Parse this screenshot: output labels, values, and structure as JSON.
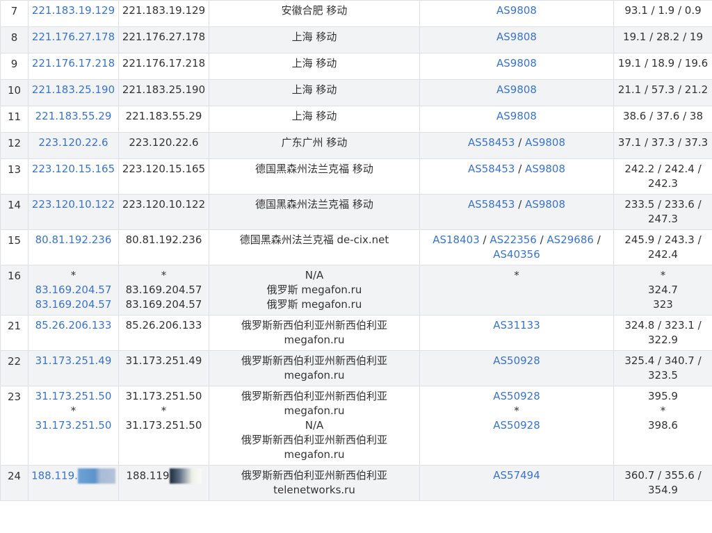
{
  "colors": {
    "link": "#3b73c7",
    "text": "#333333",
    "border": "#dcdfe3",
    "row_alt": "#f1f3f5"
  },
  "rows": [
    {
      "hop": "7",
      "ip_link": [
        "221.183.19.129"
      ],
      "ip": [
        "221.183.19.129"
      ],
      "location": [
        "安徽合肥 移动"
      ],
      "asn": [
        [
          "AS9808"
        ]
      ],
      "latency": [
        "93.1 / 1.9 / 0.9"
      ]
    },
    {
      "hop": "8",
      "ip_link": [
        "221.176.27.178"
      ],
      "ip": [
        "221.176.27.178"
      ],
      "location": [
        "上海 移动"
      ],
      "asn": [
        [
          "AS9808"
        ]
      ],
      "latency": [
        "19.1 / 28.2 / 19"
      ]
    },
    {
      "hop": "9",
      "ip_link": [
        "221.176.17.218"
      ],
      "ip": [
        "221.176.17.218"
      ],
      "location": [
        "上海 移动"
      ],
      "asn": [
        [
          "AS9808"
        ]
      ],
      "latency": [
        "19.1 / 18.9 / 19.6"
      ]
    },
    {
      "hop": "10",
      "ip_link": [
        "221.183.25.190"
      ],
      "ip": [
        "221.183.25.190"
      ],
      "location": [
        "上海 移动"
      ],
      "asn": [
        [
          "AS9808"
        ]
      ],
      "latency": [
        "21.1 / 57.3 / 21.2"
      ]
    },
    {
      "hop": "11",
      "ip_link": [
        "221.183.55.29"
      ],
      "ip": [
        "221.183.55.29"
      ],
      "location": [
        "上海 移动"
      ],
      "asn": [
        [
          "AS9808"
        ]
      ],
      "latency": [
        "38.6 / 37.6 / 38"
      ]
    },
    {
      "hop": "12",
      "ip_link": [
        "223.120.22.6"
      ],
      "ip": [
        "223.120.22.6"
      ],
      "location": [
        "广东广州 移动"
      ],
      "asn": [
        [
          "AS58453",
          "AS9808"
        ]
      ],
      "latency": [
        "37.1 / 37.3 / 37.3"
      ]
    },
    {
      "hop": "13",
      "ip_link": [
        "223.120.15.165"
      ],
      "ip": [
        "223.120.15.165"
      ],
      "location": [
        "德国黑森州法兰克福 移动"
      ],
      "asn": [
        [
          "AS58453",
          "AS9808"
        ]
      ],
      "latency": [
        "242.2 / 242.4 /",
        "242.3"
      ]
    },
    {
      "hop": "14",
      "ip_link": [
        "223.120.10.122"
      ],
      "ip": [
        "223.120.10.122"
      ],
      "location": [
        "德国黑森州法兰克福 移动"
      ],
      "asn": [
        [
          "AS58453",
          "AS9808"
        ]
      ],
      "latency": [
        "233.5 / 233.6 /",
        "247.3"
      ]
    },
    {
      "hop": "15",
      "ip_link": [
        "80.81.192.236"
      ],
      "ip": [
        "80.81.192.236"
      ],
      "location": [
        "德国黑森州法兰克福 de-cix.net"
      ],
      "asn": [
        [
          "AS18403",
          "AS22356",
          "AS29686",
          ""
        ],
        [
          "AS40356"
        ]
      ],
      "latency": [
        "245.9 / 243.3 /",
        "242.4"
      ]
    },
    {
      "hop": "16",
      "ip_link": [
        "*",
        "83.169.204.57",
        "83.169.204.57"
      ],
      "ip": [
        "*",
        "83.169.204.57",
        "83.169.204.57"
      ],
      "location": [
        "N/A",
        "俄罗斯 megafon.ru",
        "俄罗斯 megafon.ru"
      ],
      "asn_plain": [
        "*"
      ],
      "latency": [
        "*",
        "324.7",
        "323"
      ]
    },
    {
      "hop": "21",
      "ip_link": [
        "85.26.206.133"
      ],
      "ip": [
        "85.26.206.133"
      ],
      "location": [
        "俄罗斯新西伯利亚州新西伯利亚",
        "megafon.ru"
      ],
      "asn": [
        [
          "AS31133"
        ]
      ],
      "latency": [
        "324.8 / 323.1 /",
        "322.9"
      ]
    },
    {
      "hop": "22",
      "ip_link": [
        "31.173.251.49"
      ],
      "ip": [
        "31.173.251.49"
      ],
      "location": [
        "俄罗斯新西伯利亚州新西伯利亚",
        "megafon.ru"
      ],
      "asn": [
        [
          "AS50928"
        ]
      ],
      "latency": [
        "325.4 / 340.7 /",
        "323.5"
      ]
    },
    {
      "hop": "23",
      "ip_link": [
        "31.173.251.50",
        "*",
        "31.173.251.50"
      ],
      "ip": [
        "31.173.251.50",
        "*",
        "31.173.251.50"
      ],
      "location": [
        "俄罗斯新西伯利亚州新西伯利亚",
        "megafon.ru",
        "N/A",
        "俄罗斯新西伯利亚州新西伯利亚",
        "megafon.ru"
      ],
      "asn_mixed": [
        "AS50928",
        "*",
        "AS50928"
      ],
      "latency": [
        "395.9",
        "*",
        "398.6"
      ]
    },
    {
      "hop": "24",
      "ip_link_partial": "188.119.",
      "ip_partial": "188.119",
      "location": [
        "俄罗斯新西伯利亚州新西伯利亚",
        "telenetworks.ru"
      ],
      "asn": [
        [
          "AS57494"
        ]
      ],
      "latency": [
        "360.7 / 355.6 /",
        "354.9"
      ]
    }
  ]
}
